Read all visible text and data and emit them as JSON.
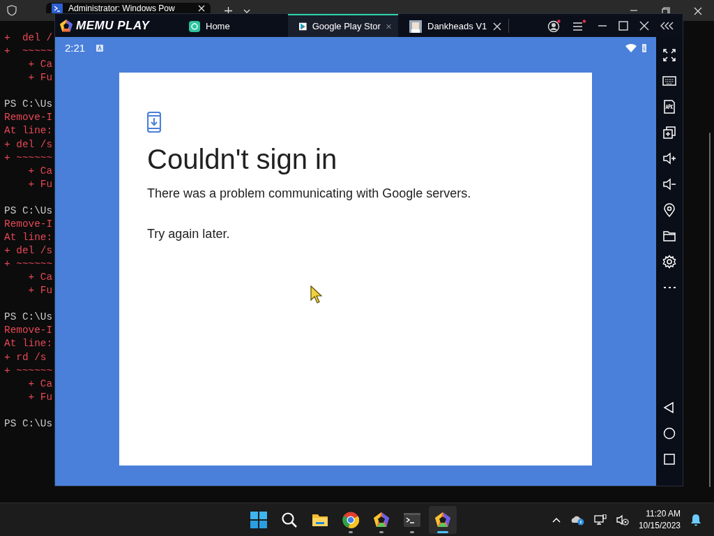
{
  "terminal": {
    "tab_title": "Administrator: Windows Pow",
    "lines": [
      {
        "kind": "error",
        "text": "+  del /"
      },
      {
        "kind": "error",
        "text": "+  ~~~~~"
      },
      {
        "kind": "error",
        "text": "    + Ca"
      },
      {
        "kind": "error",
        "text": "    + Fu"
      },
      {
        "kind": "blank"
      },
      {
        "kind": "prompt",
        "text": "PS C:\\Us"
      },
      {
        "kind": "error",
        "text": "Remove-I"
      },
      {
        "kind": "error",
        "text": "At line:"
      },
      {
        "kind": "error",
        "text": "+ del /s"
      },
      {
        "kind": "error",
        "text": "+ ~~~~~~"
      },
      {
        "kind": "error",
        "text": "    + Ca"
      },
      {
        "kind": "error",
        "text": "    + Fu"
      },
      {
        "kind": "blank"
      },
      {
        "kind": "prompt",
        "text": "PS C:\\Us"
      },
      {
        "kind": "error",
        "text": "Remove-I"
      },
      {
        "kind": "error",
        "text": "At line:"
      },
      {
        "kind": "error",
        "text": "+ del /s"
      },
      {
        "kind": "error",
        "text": "+ ~~~~~~"
      },
      {
        "kind": "error",
        "text": "    + Ca"
      },
      {
        "kind": "error",
        "text": "    + Fu"
      },
      {
        "kind": "blank"
      },
      {
        "kind": "prompt",
        "text": "PS C:\\Us"
      },
      {
        "kind": "error",
        "text": "Remove-I"
      },
      {
        "kind": "error",
        "text": "At line:"
      },
      {
        "kind": "error",
        "text": "+ rd /s"
      },
      {
        "kind": "error",
        "text": "+ ~~~~~~"
      },
      {
        "kind": "error",
        "text": "    + Ca"
      },
      {
        "kind": "error",
        "text": "    + Fu"
      },
      {
        "kind": "blank"
      },
      {
        "kind": "prompt",
        "text": "PS C:\\Us"
      }
    ]
  },
  "emulator": {
    "logo": "MEMU PLAY",
    "tabs": [
      {
        "kind": "home",
        "label": "Home",
        "selected": false
      },
      {
        "kind": "store",
        "label": "Google Play Stor",
        "selected": true
      },
      {
        "kind": "game",
        "label": "Dankheads V1",
        "selected": false
      }
    ],
    "status_bar": {
      "time": "2:21"
    },
    "dialog": {
      "title": "Couldn't sign in",
      "message": "There was a problem communicating with Google servers.",
      "note": "Try again later."
    }
  },
  "taskbar": {
    "apps": [
      {
        "kind": "start",
        "running": false,
        "selected": false
      },
      {
        "kind": "search",
        "running": false,
        "selected": false
      },
      {
        "kind": "explorer",
        "running": false,
        "selected": false
      },
      {
        "kind": "chrome",
        "running": true,
        "selected": false
      },
      {
        "kind": "memu",
        "running": true,
        "selected": false
      },
      {
        "kind": "terminal",
        "running": true,
        "selected": false
      },
      {
        "kind": "memu",
        "running": true,
        "selected": true
      }
    ],
    "time": "11:20 AM",
    "date": "10/15/2023"
  }
}
